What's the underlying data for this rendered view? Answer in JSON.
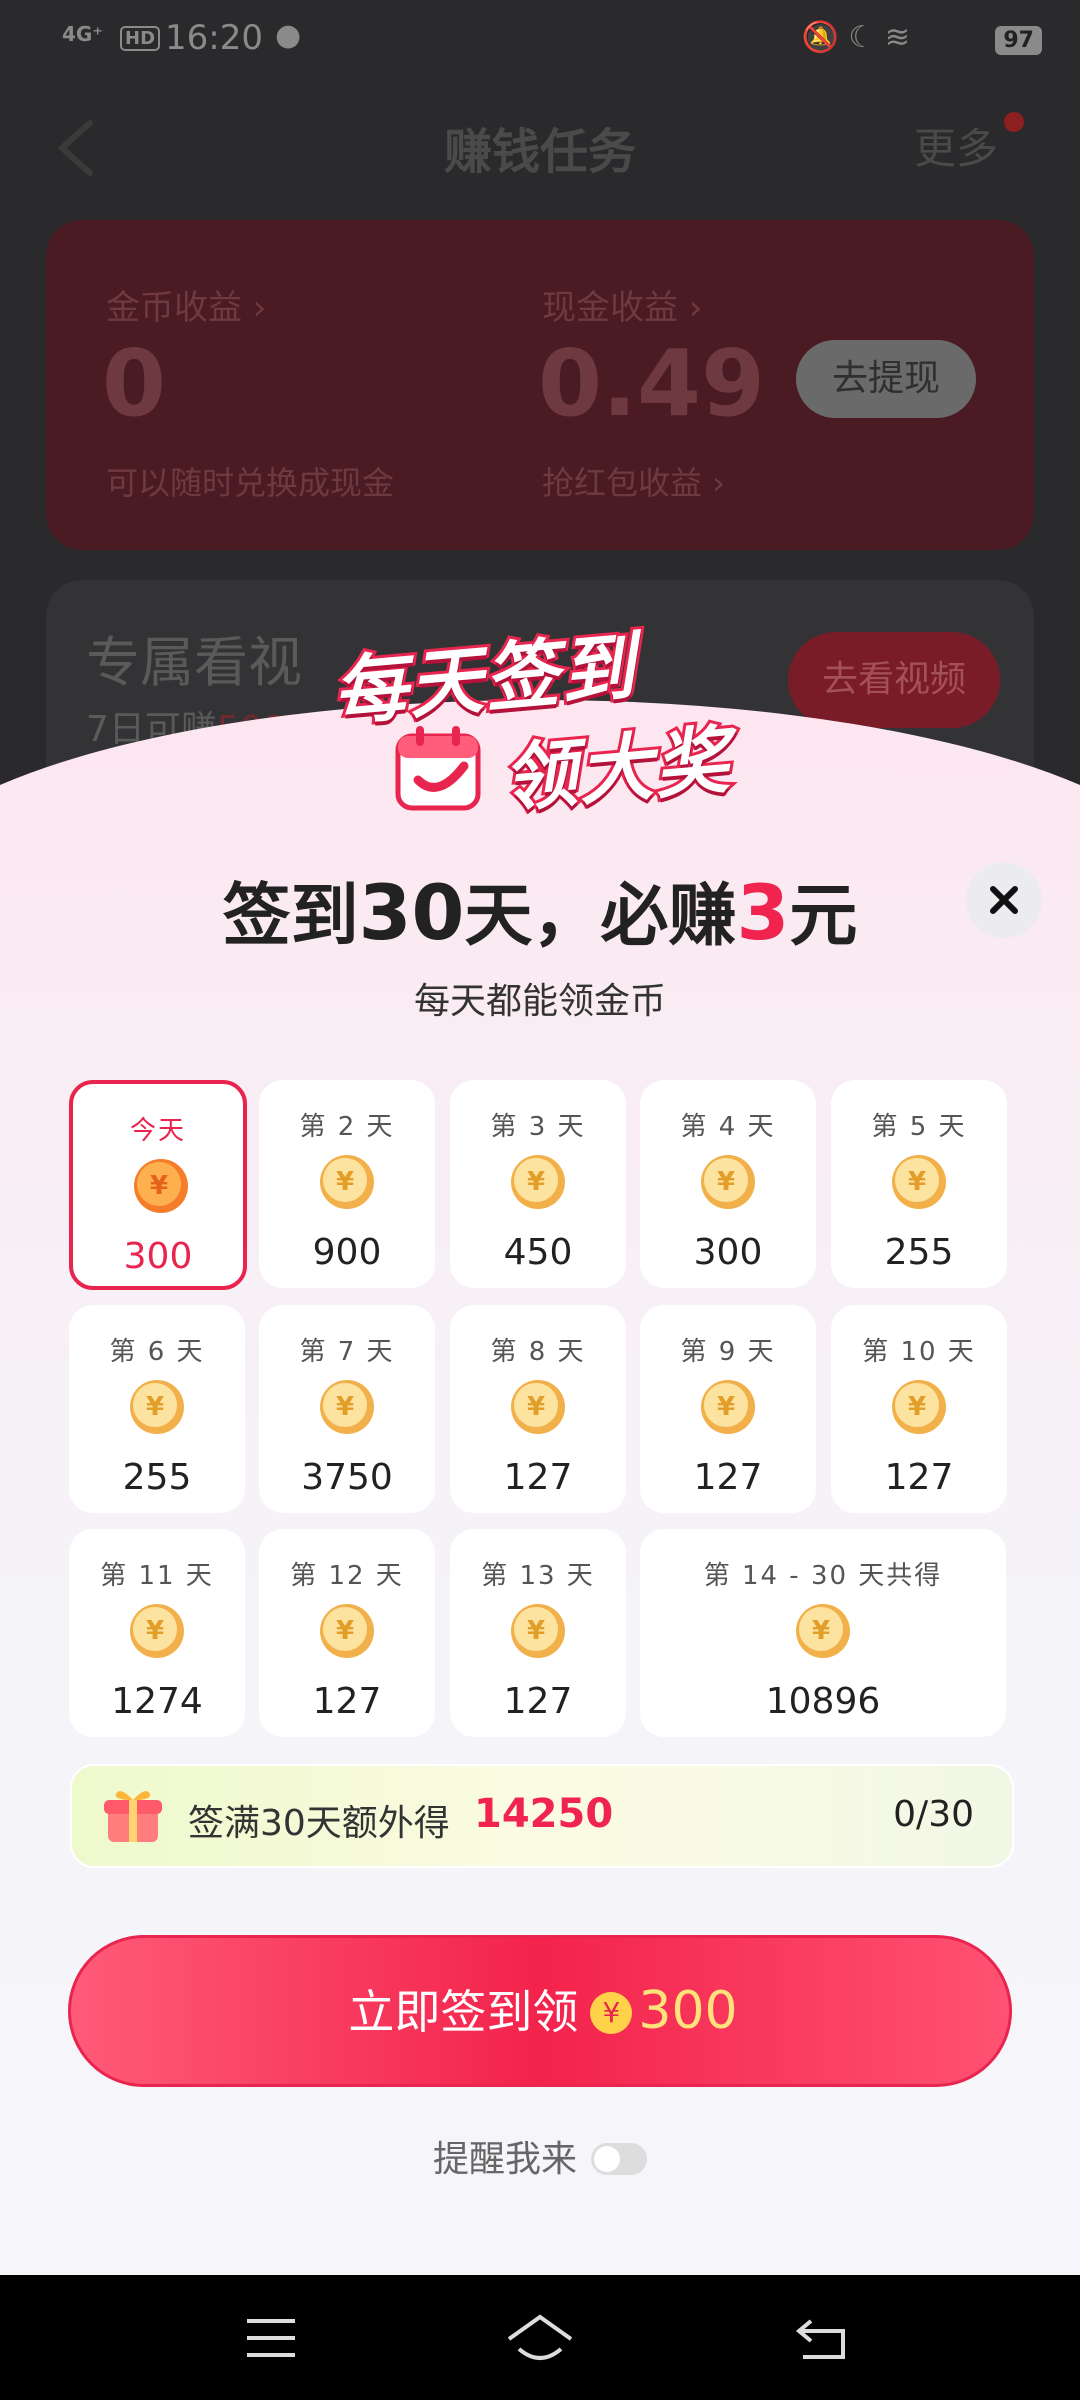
{
  "status_bar": {
    "network": "4G⁺",
    "hd": "HD",
    "time": "16:20",
    "battery": "97"
  },
  "header": {
    "title": "赚钱任务",
    "more": "更多"
  },
  "earnings": {
    "coin_label": "金币收益 ›",
    "coin_value": "0",
    "coin_sub": "可以随时兑换成现金",
    "cash_label": "现金收益 ›",
    "cash_value": "0.49",
    "cash_sub": "抢红包收益 ›",
    "withdraw": "去提现"
  },
  "video_card": {
    "title": "专属看视",
    "sub_prefix": "7日可赚",
    "sub_value": "500",
    "button": "去看视频"
  },
  "banner": {
    "line1": "每天签到",
    "line2": "领大奖"
  },
  "headline": {
    "p1": "签到",
    "n1": "30",
    "p2": "天，必赚",
    "n2": "3",
    "p3": "元"
  },
  "subline": "每天都能领金币",
  "days": [
    {
      "label": "今天",
      "value": "300"
    },
    {
      "label": "第 2 天",
      "value": "900"
    },
    {
      "label": "第 3 天",
      "value": "450"
    },
    {
      "label": "第 4 天",
      "value": "300"
    },
    {
      "label": "第 5 天",
      "value": "255"
    },
    {
      "label": "第 6 天",
      "value": "255"
    },
    {
      "label": "第 7 天",
      "value": "3750"
    },
    {
      "label": "第 8 天",
      "value": "127"
    },
    {
      "label": "第 9 天",
      "value": "127"
    },
    {
      "label": "第 10 天",
      "value": "127"
    },
    {
      "label": "第 11 天",
      "value": "1274"
    },
    {
      "label": "第 12 天",
      "value": "127"
    },
    {
      "label": "第 13 天",
      "value": "127"
    },
    {
      "label": "第 14 - 30 天共得",
      "value": "10896"
    }
  ],
  "bonus": {
    "label": "签满30天额外得",
    "value": "14250",
    "progress": "0/30"
  },
  "sign_button": {
    "label": "立即签到领",
    "coin": "¥",
    "amount": "300"
  },
  "remind": "提醒我来",
  "colors": {
    "accent": "#f0244e",
    "coin": "#f5b23a"
  }
}
